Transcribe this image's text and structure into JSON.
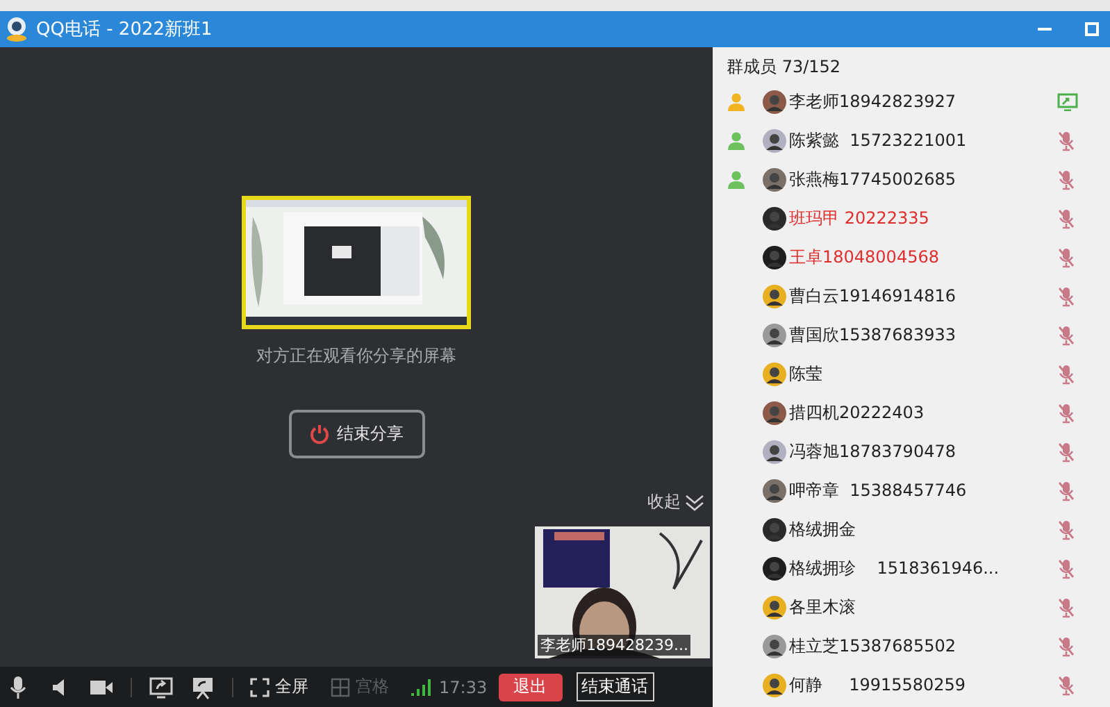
{
  "window": {
    "title": "QQ电话 - 2022新班1"
  },
  "share": {
    "caption": "对方正在观看你分享的屏幕",
    "stop_button": "结束分享"
  },
  "video": {
    "collapse": "收起",
    "caption": "李老师189428239..."
  },
  "toolbar": {
    "fullscreen": "全屏",
    "grid": {
      "label": "宫格",
      "disabled": true
    },
    "time": "17:33",
    "exit": "退出",
    "end_call": "结束通话"
  },
  "members": {
    "title": "群成员 73/152",
    "items": [
      {
        "name": "李老师18942823927",
        "color": "#f0b321",
        "highlight": false,
        "sharing": true,
        "muted": false
      },
      {
        "name": "陈紫懿  15723221001",
        "color": "#6dc25e",
        "highlight": false,
        "sharing": false,
        "muted": true
      },
      {
        "name": "张燕梅17745002685",
        "color": "#6dc25e",
        "highlight": false,
        "sharing": false,
        "muted": true
      },
      {
        "name": "班玛甲 20222335",
        "highlight": true,
        "sharing": false,
        "muted": true
      },
      {
        "name": "王卓18048004568",
        "highlight": true,
        "sharing": false,
        "muted": true
      },
      {
        "name": "曹白云19146914816",
        "highlight": false,
        "sharing": false,
        "muted": true
      },
      {
        "name": "曹国欣15387683933",
        "highlight": false,
        "sharing": false,
        "muted": true
      },
      {
        "name": "陈莹",
        "highlight": false,
        "sharing": false,
        "muted": true
      },
      {
        "name": "措四机20222403",
        "highlight": false,
        "sharing": false,
        "muted": true
      },
      {
        "name": "冯蓉旭18783790478",
        "highlight": false,
        "sharing": false,
        "muted": true
      },
      {
        "name": "呷帝章  15388457746",
        "highlight": false,
        "sharing": false,
        "muted": true
      },
      {
        "name": "格绒拥金",
        "highlight": false,
        "sharing": false,
        "muted": true
      },
      {
        "name": "格绒拥珍    1518361946...",
        "highlight": false,
        "sharing": false,
        "muted": true
      },
      {
        "name": "各里木滚",
        "highlight": false,
        "sharing": false,
        "muted": true
      },
      {
        "name": "桂立芝15387685502",
        "highlight": false,
        "sharing": false,
        "muted": true
      },
      {
        "name": "何静     19915580259",
        "highlight": false,
        "sharing": false,
        "muted": true
      }
    ]
  }
}
